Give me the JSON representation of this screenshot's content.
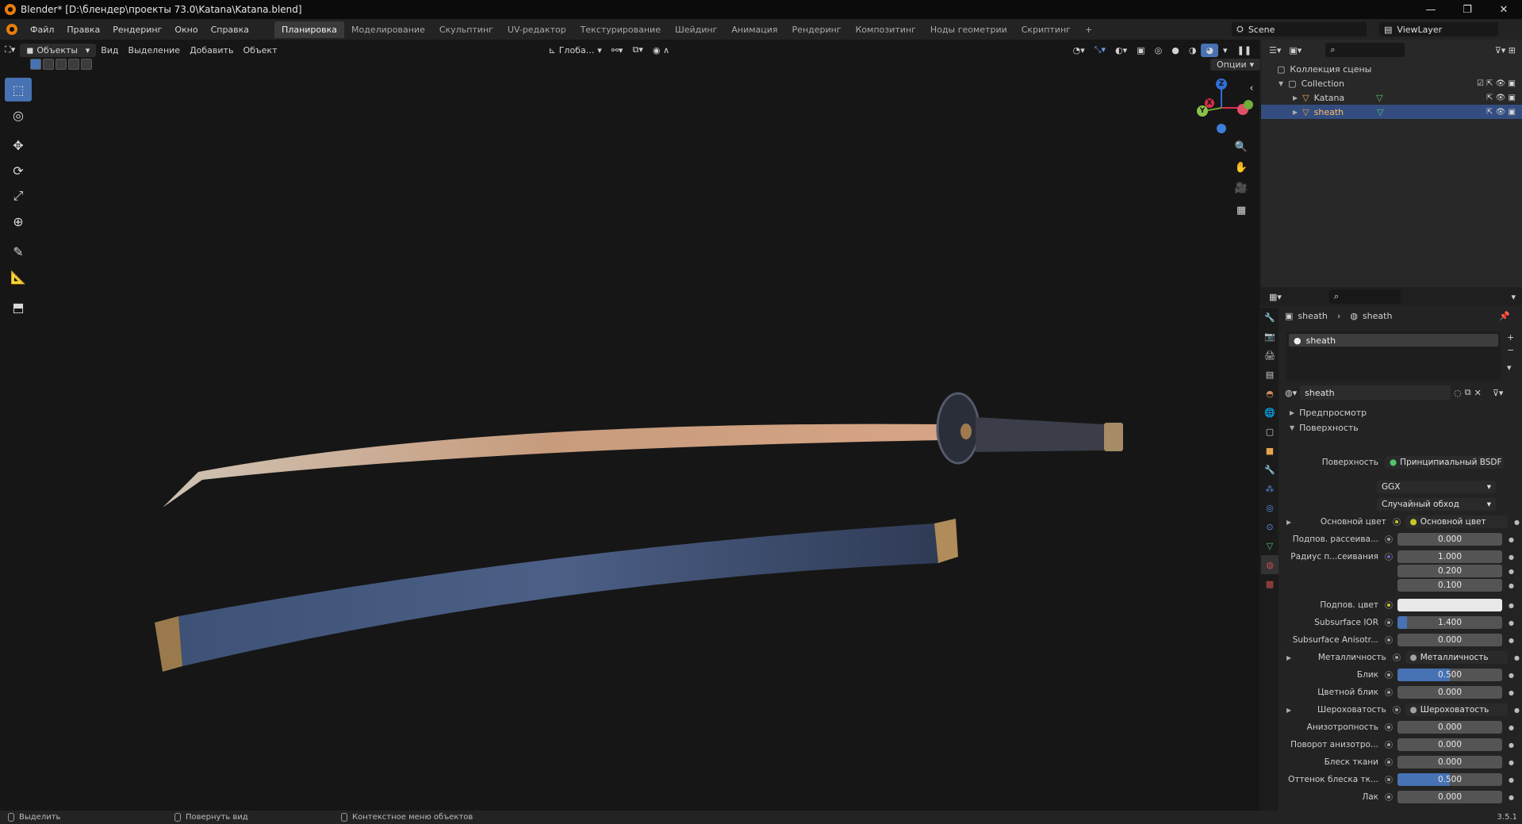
{
  "window": {
    "title": "Blender* [D:\\блендер\\проекты 73.0\\Katana\\Katana.blend]",
    "controls": [
      "—",
      "❐",
      "✕"
    ]
  },
  "menu": {
    "items": [
      "Файл",
      "Правка",
      "Рендеринг",
      "Окно",
      "Справка"
    ],
    "workspaces": [
      "Планировка",
      "Моделирование",
      "Скульптинг",
      "UV-редактор",
      "Текстурирование",
      "Шейдинг",
      "Анимация",
      "Рендеринг",
      "Композитинг",
      "Ноды геометрии",
      "Скриптинг"
    ],
    "active_workspace": "Планировка",
    "add_tab": "+",
    "scene_name": "Scene",
    "view_layer": "ViewLayer"
  },
  "viewport": {
    "mode": "Объекты",
    "menus": [
      "Вид",
      "Выделение",
      "Добавить",
      "Объект"
    ],
    "orientation": "Глоба...",
    "options": "Опции"
  },
  "gizmo": {
    "x": "X",
    "y": "Y",
    "z": "Z"
  },
  "outliner": {
    "root": "Коллекция сцены",
    "collection": "Collection",
    "objects": [
      {
        "name": "Katana",
        "selected": false
      },
      {
        "name": "sheath",
        "selected": true
      }
    ]
  },
  "properties": {
    "breadcrumb_object": "sheath",
    "breadcrumb_material": "sheath",
    "slot_name": "sheath",
    "material_name": "sheath",
    "sections": {
      "preview": "Предпросмотр",
      "surface": "Поверхность"
    },
    "surface_label": "Поверхность",
    "surface_shader": "Принципиальный BSDF",
    "distribution": "GGX",
    "subsurface_method": "Случайный обход",
    "fields": [
      {
        "label": "Основной цвет",
        "type": "link",
        "value": "Основной цвет",
        "dot": "yellow",
        "expand": true
      },
      {
        "label": "Подпов. рассеива...",
        "type": "num",
        "value": "0.000",
        "dot": "grey",
        "fill": 0
      },
      {
        "label": "Радиус п...сеивания",
        "type": "num",
        "value": "1.000",
        "dot": "blue",
        "fill": 0
      },
      {
        "label": "",
        "type": "num",
        "value": "0.200",
        "dot": "",
        "fill": 0
      },
      {
        "label": "",
        "type": "num",
        "value": "0.100",
        "dot": "",
        "fill": 0
      },
      {
        "label": "Подпов. цвет",
        "type": "color",
        "value": "",
        "dot": "yellow",
        "fill": 0
      },
      {
        "label": "Subsurface IOR",
        "type": "num",
        "value": "1.400",
        "dot": "grey",
        "fill": 0.09
      },
      {
        "label": "Subsurface Anisotr...",
        "type": "num",
        "value": "0.000",
        "dot": "grey",
        "fill": 0
      },
      {
        "label": "Металличность",
        "type": "link",
        "value": "Металличность",
        "dot": "grey",
        "expand": true
      },
      {
        "label": "Блик",
        "type": "num",
        "value": "0.500",
        "dot": "grey",
        "fill": 0.5
      },
      {
        "label": "Цветной блик",
        "type": "num",
        "value": "0.000",
        "dot": "grey",
        "fill": 0
      },
      {
        "label": "Шероховатость",
        "type": "link",
        "value": "Шероховатость",
        "dot": "grey",
        "expand": true
      },
      {
        "label": "Анизотропность",
        "type": "num",
        "value": "0.000",
        "dot": "grey",
        "fill": 0
      },
      {
        "label": "Поворот анизотро...",
        "type": "num",
        "value": "0.000",
        "dot": "grey",
        "fill": 0
      },
      {
        "label": "Блеск ткани",
        "type": "num",
        "value": "0.000",
        "dot": "grey",
        "fill": 0
      },
      {
        "label": "Оттенок блеска тк...",
        "type": "num",
        "value": "0.500",
        "dot": "grey",
        "fill": 0.5
      },
      {
        "label": "Лак",
        "type": "num",
        "value": "0.000",
        "dot": "grey",
        "fill": 0
      }
    ]
  },
  "status": {
    "select": "Выделить",
    "rotate": "Повернуть вид",
    "context": "Контекстное меню объектов",
    "version": "3.5.1"
  },
  "colors": {
    "accent": "#4772b3",
    "selection": "#334d80",
    "blender_orange": "#e87d0d"
  }
}
